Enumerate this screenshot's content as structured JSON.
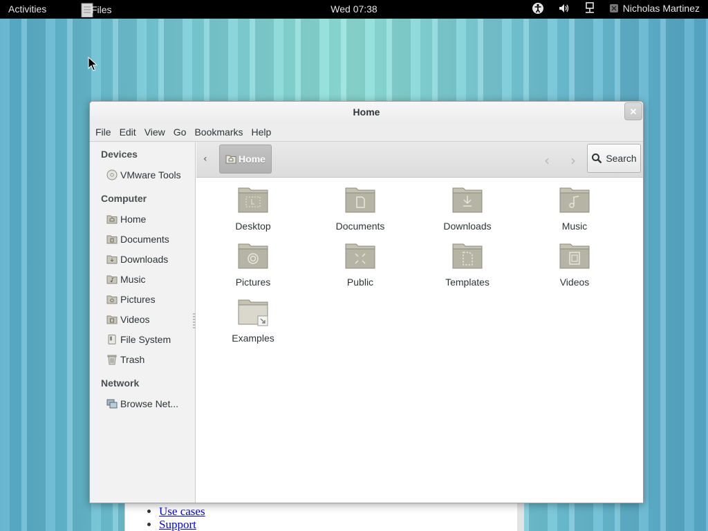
{
  "top_panel": {
    "activities": "Activities",
    "app_name": "Files",
    "clock": "Wed 07:38",
    "user_name": "Nicholas Martinez"
  },
  "window": {
    "title": "Home",
    "menu": [
      "File",
      "Edit",
      "View",
      "Go",
      "Bookmarks",
      "Help"
    ]
  },
  "sidebar": {
    "sections": [
      {
        "title": "Devices",
        "items": [
          {
            "label": "VMware Tools",
            "icon": "disc-icon"
          }
        ]
      },
      {
        "title": "Computer",
        "items": [
          {
            "label": "Home",
            "icon": "home-folder-icon"
          },
          {
            "label": "Documents",
            "icon": "documents-folder-icon"
          },
          {
            "label": "Downloads",
            "icon": "downloads-folder-icon"
          },
          {
            "label": "Music",
            "icon": "music-folder-icon"
          },
          {
            "label": "Pictures",
            "icon": "pictures-folder-icon"
          },
          {
            "label": "Videos",
            "icon": "videos-folder-icon"
          },
          {
            "label": "File System",
            "icon": "drive-icon"
          },
          {
            "label": "Trash",
            "icon": "trash-icon"
          }
        ]
      },
      {
        "title": "Network",
        "items": [
          {
            "label": "Browse Net...",
            "icon": "network-icon"
          }
        ]
      }
    ]
  },
  "toolbar": {
    "path_label": "Home",
    "search_label": "Search"
  },
  "files": [
    {
      "label": "Desktop",
      "icon": "desktop-folder-icon"
    },
    {
      "label": "Documents",
      "icon": "documents-folder-icon"
    },
    {
      "label": "Downloads",
      "icon": "downloads-folder-icon"
    },
    {
      "label": "Music",
      "icon": "music-folder-icon"
    },
    {
      "label": "Pictures",
      "icon": "pictures-folder-icon"
    },
    {
      "label": "Public",
      "icon": "public-folder-icon"
    },
    {
      "label": "Templates",
      "icon": "templates-folder-icon"
    },
    {
      "label": "Videos",
      "icon": "videos-folder-icon"
    },
    {
      "label": "Examples",
      "icon": "examples-link-folder-icon"
    }
  ],
  "background_page": {
    "links": [
      "Use cases",
      "Support"
    ]
  },
  "colors": {
    "panel": "#000000",
    "window_bg": "#ffffff",
    "sidebar_bg": "#f2f2f2",
    "folder": "#b5b3a3",
    "link": "#0000ee"
  }
}
